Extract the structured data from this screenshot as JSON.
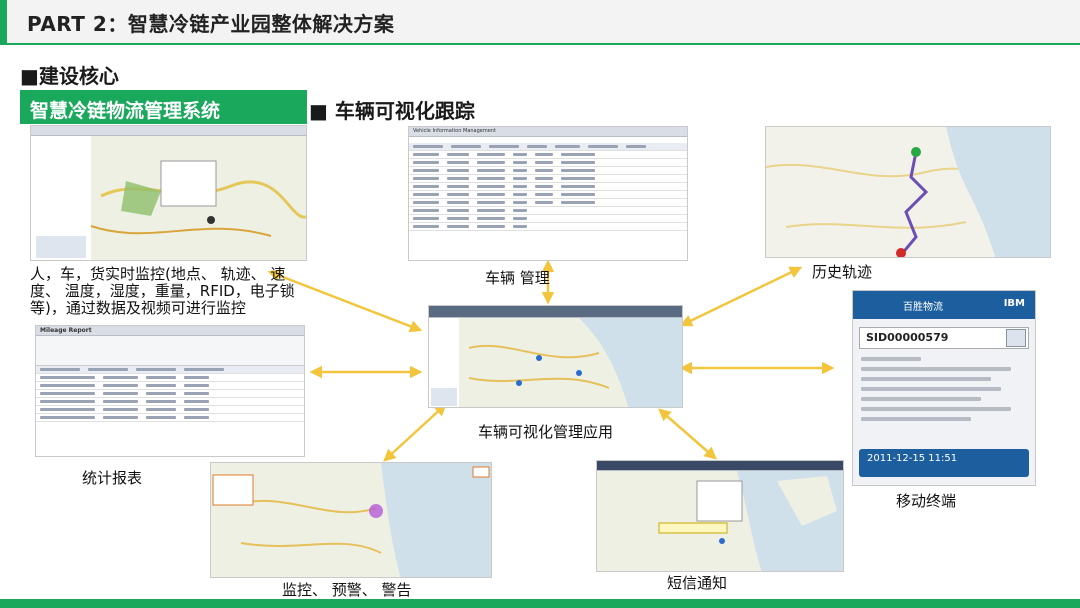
{
  "header": {
    "title": "PART 2：智慧冷链产业园整体解决方案"
  },
  "section": {
    "core_title": "■建设核心",
    "banner": "智慧冷链物流管理系统",
    "subtitle": "■   车辆可视化跟踪"
  },
  "captions": {
    "monitor_desc": "人，车，货实时监控(地点、 轨迹、 速度、 温度，湿度，重量，RFID，电子锁等)，通过数据及视频可进行监控",
    "vehicle_manage": "车辆  管理",
    "history_track": "历史轨迹",
    "center_app": "车辆可视化管理应用",
    "stats_report": "统计报表",
    "mobile_terminal": "移动终端",
    "alert": "监控、 预警、 警告",
    "sms": "短信通知"
  },
  "screens": {
    "vehicle_table_title": "Vehicle Information Management",
    "mileage_title": "Mileage Report",
    "mobile_brand": "百胜物流",
    "mobile_ibm": "IBM",
    "mobile_query_id": "SID00000579",
    "mobile_footer_time": "2011-12-15 11:51"
  },
  "colors": {
    "accent_green": "#1aa85c",
    "arrow_yellow": "#f2c53d"
  }
}
